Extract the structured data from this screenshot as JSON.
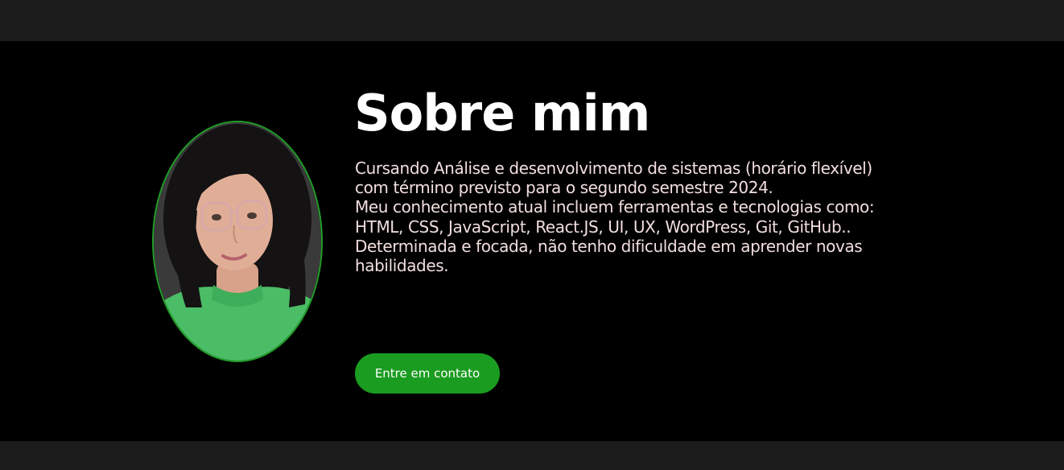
{
  "about": {
    "title": "Sobre mim",
    "paragraph_lines": [
      "Cursando Análise e desenvolvimento de sistemas (horário flexível) com término previsto para o segundo semestre 2024.",
      "Meu conhecimento atual incluem ferramentas e tecnologias como:",
      "HTML, CSS, JavaScript, React.JS, UI, UX, WordPress, Git, GitHub..",
      "Determinada e focada, não tenho dificuldade em aprender novas habilidades."
    ],
    "contact_button_label": "Entre em contato",
    "accent_color": "#1a9c20",
    "photo_icon": "profile-photo"
  }
}
